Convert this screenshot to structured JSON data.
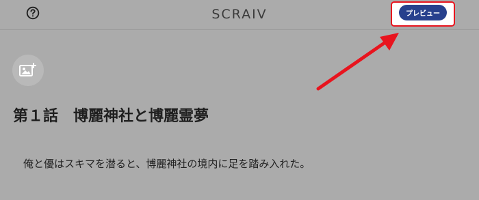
{
  "header": {
    "app_title": "SCRAIV",
    "help_icon": "question-circle-icon",
    "preview_label": "プレビュー"
  },
  "editor": {
    "add_image_icon": "add-image-icon",
    "chapter_title": "第１話　博麗神社と博麗霊夢",
    "body_text": "俺と優はスキマを潜ると、博麗神社の境内に足を踏み入れた。"
  },
  "annotation": {
    "highlight_color": "#e8141e",
    "arrow_color": "#e8141e"
  },
  "colors": {
    "background": "#ababab",
    "preview_button": "#27408d"
  }
}
